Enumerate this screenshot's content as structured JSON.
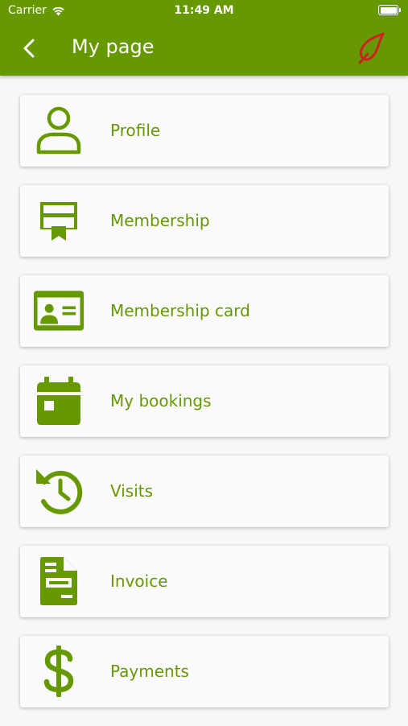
{
  "status": {
    "carrier": "Carrier",
    "time": "11:49 AM"
  },
  "nav": {
    "title": "My page"
  },
  "colors": {
    "accent": "#669900",
    "logo": "#cc2222",
    "background": "#f7f7f7"
  },
  "menu": [
    {
      "label": "Profile",
      "icon": "user-icon"
    },
    {
      "label": "Membership",
      "icon": "certificate-icon"
    },
    {
      "label": "Membership card",
      "icon": "id-card-icon"
    },
    {
      "label": "My bookings",
      "icon": "calendar-icon"
    },
    {
      "label": "Visits",
      "icon": "history-icon"
    },
    {
      "label": "Invoice",
      "icon": "invoice-icon"
    },
    {
      "label": "Payments",
      "icon": "dollar-icon"
    }
  ]
}
